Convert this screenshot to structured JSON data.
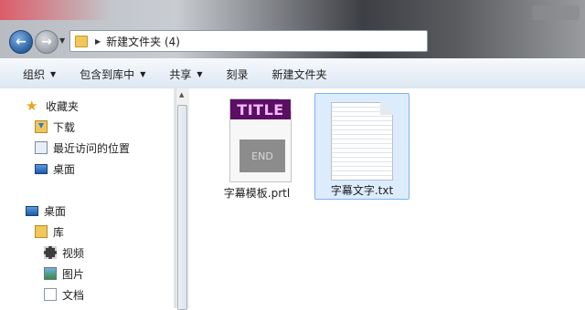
{
  "window": {
    "address_path": "新建文件夹 (4)"
  },
  "toolbar": {
    "items": [
      "组织",
      "包含到库中",
      "共享",
      "刻录",
      "新建文件夹"
    ]
  },
  "nav": {
    "favorites_label": "收藏夹",
    "favorites": [
      "下载",
      "最近访问的位置",
      "桌面"
    ],
    "desktop_label": "桌面",
    "library_label": "库",
    "libraries": [
      "视频",
      "图片",
      "文档"
    ]
  },
  "files": [
    {
      "name": "字幕模板.prtl",
      "thumb_top": "TITLE",
      "thumb_bottom": "END",
      "icon": "premiere-title-thumbnail"
    },
    {
      "name": "字幕文字.txt",
      "icon": "text-file-icon",
      "selected": true
    }
  ],
  "colors": {
    "toolbar_bg": "#dde6f1",
    "selection": "#dcecfc",
    "title_thumb_bg": "#5a0f63",
    "title_thumb_text": "#f3b8ff"
  }
}
